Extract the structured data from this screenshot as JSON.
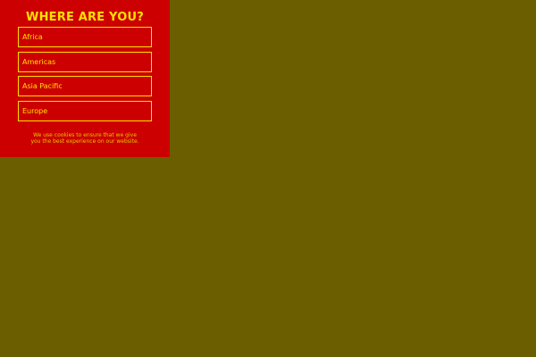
{
  "panel": {
    "title": "WHERE ARE YOU?",
    "regions": [
      {
        "label": "Africa"
      },
      {
        "label": "Americas"
      },
      {
        "label": "Asia Pacific"
      },
      {
        "label": "Europe"
      }
    ],
    "cookie_line1": "We use cookies to ensure that we give",
    "cookie_line2": "you the best experience on our website."
  },
  "colors": {
    "page_background": "#6b5e00",
    "panel_background": "#cc0000",
    "accent": "#ffe000"
  }
}
